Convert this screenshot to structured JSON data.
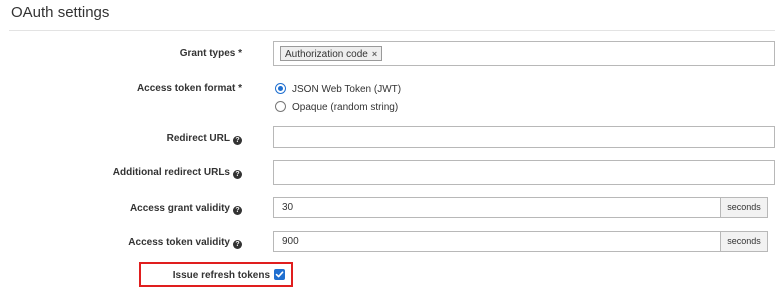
{
  "section": {
    "title": "OAuth settings"
  },
  "grant_types": {
    "label": "Grant types *",
    "chips": [
      {
        "label": "Authorization code",
        "remove_glyph": "×"
      }
    ]
  },
  "access_token_format": {
    "label": "Access token format *",
    "options": [
      {
        "label": "JSON Web Token (JWT)",
        "checked": true
      },
      {
        "label": "Opaque (random string)",
        "checked": false
      }
    ]
  },
  "redirect_url": {
    "label": "Redirect URL",
    "value": ""
  },
  "additional_redirect_urls": {
    "label": "Additional redirect URLs",
    "value": ""
  },
  "access_grant_validity": {
    "label": "Access grant validity",
    "value": "30",
    "unit": "seconds"
  },
  "access_token_validity": {
    "label": "Access token validity",
    "value": "900",
    "unit": "seconds"
  },
  "issue_refresh_tokens": {
    "label": "Issue refresh tokens",
    "checked": true
  },
  "icons": {
    "help": "question-circle-icon",
    "check": "checkmark-icon"
  },
  "colors": {
    "accent": "#1f6fd0",
    "highlight": "#e01e1e",
    "border": "#b8b8b8"
  }
}
